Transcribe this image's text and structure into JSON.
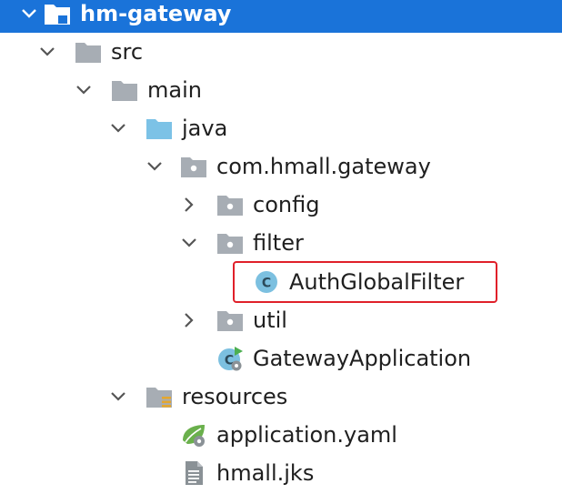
{
  "tree": {
    "root": {
      "label": "hm-gateway"
    },
    "src": {
      "label": "src"
    },
    "main": {
      "label": "main"
    },
    "java": {
      "label": "java"
    },
    "package": {
      "label": "com.hmall.gateway"
    },
    "config": {
      "label": "config"
    },
    "filter": {
      "label": "filter"
    },
    "auth_filter": {
      "label": "AuthGlobalFilter",
      "highlight_color": "#e0202a"
    },
    "util": {
      "label": "util"
    },
    "gateway_app": {
      "label": "GatewayApplication"
    },
    "resources": {
      "label": "resources"
    },
    "application_yaml": {
      "label": "application.yaml"
    },
    "hmall_jks": {
      "label": "hmall.jks"
    }
  },
  "colors": {
    "selection": "#1a73d9",
    "folder": "#a7adb4",
    "java_folder": "#7cc2e6",
    "class_icon": "#7cc0e0",
    "spring_green": "#6ab04c"
  }
}
